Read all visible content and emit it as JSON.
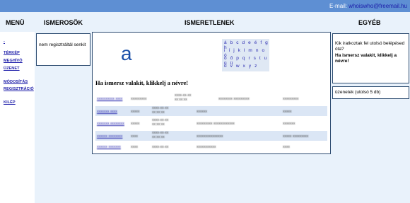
{
  "header": {
    "email_label": "E-mail:",
    "email_address": "whoiswho@freemail.hu"
  },
  "columns": {
    "menu": "MENÜ",
    "known": "ISMEROSÖK",
    "unknown": "ISMERETLENEK",
    "other": "EGYÉB"
  },
  "sidebar": {
    "items": [
      "-",
      "TÉRKÉP",
      "MEGHÍVÓ",
      "ÜZENET",
      "MÓDOSÍTÁS",
      "REGISZTRÁCIÓ",
      "KILÉP"
    ]
  },
  "known": {
    "empty_text": "nem regisztráltál senkit"
  },
  "unknown": {
    "current_letter": "a",
    "alphabet_rows": [
      "á b c d e é f g h",
      "i í j k l m n o ó",
      "ö ő p q r s t u ú ü",
      "ű v w x y z"
    ],
    "click_prompt": "Ha ismersz valakit, klikkelj a névre!",
    "rows": [
      [
        "xxxxxxxxxx xxxx",
        "xxxxxxxxx",
        "xxxx-xx-xx xx:xx:xx",
        "xxxxxxxx xxxxxxxxx",
        "xxxxxxxxx"
      ],
      [
        "xxxxxxx xxxx",
        "xxxxx",
        "xxxx-xx-xx xx:xx:xx",
        "xxxxxx",
        "xxxxx"
      ],
      [
        "xxxxxxx xxxxxxxx",
        "xxxxx",
        "xxxx-xx-xx xx:xx:xx",
        "xxxxxxxxx xxxxxxxxxxxx",
        "xxxxxxx"
      ],
      [
        "xxxxxx xxxxxxxx",
        "xxxx",
        "xxxx-xx-xx xx:xx:xx",
        "xxxxxxxxxxxxxxx",
        "xxxxx xxxxxxxxx"
      ],
      [
        "xxxxxx xxxxxxx",
        "xxxx",
        "xxxx-xx-xx",
        "xxxxxxxxxxx",
        "xxxx"
      ]
    ]
  },
  "other": {
    "who_read": "Kik iratkoztak fel utolsó belépésed óta?",
    "click_prompt": "Ha ismersz valakit, klikkelj a névre!",
    "messages": "üzenetek (utolsó 5 db)"
  },
  "colors": {
    "topbar": "#5e8fd3",
    "background": "#e9f2fb",
    "box_border": "#2b4a6f",
    "link": "#1a1aa8",
    "row_band": "#dbe6f5"
  }
}
